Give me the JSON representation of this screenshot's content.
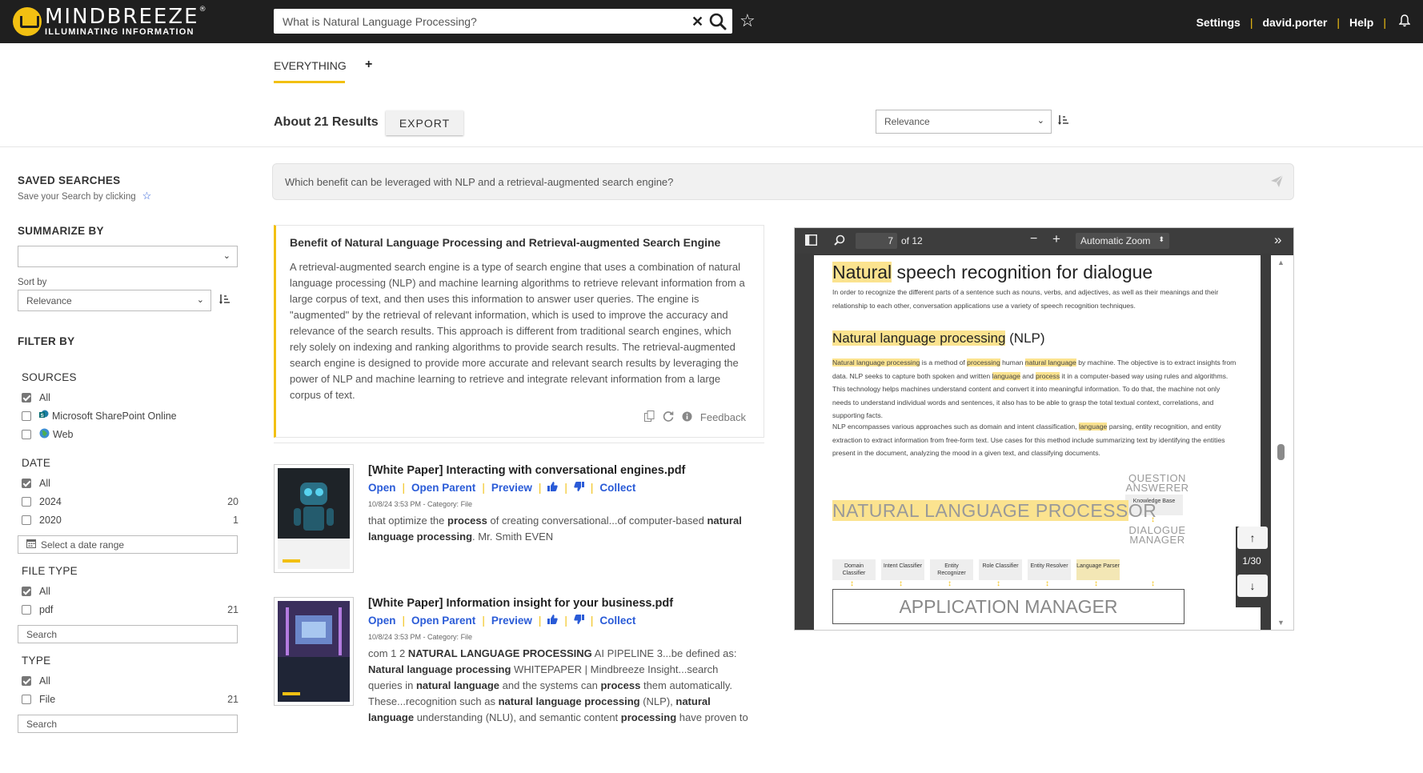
{
  "header": {
    "logo_main": "MINDBREEZE",
    "logo_reg": "®",
    "logo_sub": "ILLUMINATING INFORMATION",
    "search_value": "What is Natural Language Processing?",
    "nav": {
      "settings": "Settings",
      "user": "david.porter",
      "help": "Help"
    },
    "accent_color": "#f2c012"
  },
  "tabs": {
    "everything": "EVERYTHING",
    "add": "+"
  },
  "results_bar": {
    "count": "About 21 Results",
    "export": "EXPORT",
    "sort": "Relevance"
  },
  "ask": {
    "placeholder": "Which benefit can be leveraged with NLP and a retrieval-augmented search engine?"
  },
  "sidebar": {
    "saved_title": "SAVED SEARCHES",
    "saved_sub": "Save your Search by clicking",
    "summarize_title": "SUMMARIZE BY",
    "summarize_value": "",
    "sortby_label": "Sort by",
    "sortby_value": "Relevance",
    "filter_title": "FILTER BY",
    "sources_title": "SOURCES",
    "sources": [
      {
        "label": "All",
        "checked": true
      },
      {
        "label": "Microsoft SharePoint Online",
        "checked": false
      },
      {
        "label": "Web",
        "checked": false
      }
    ],
    "date_title": "DATE",
    "dates": [
      {
        "label": "All",
        "count": "",
        "checked": true
      },
      {
        "label": "2024",
        "count": "20",
        "checked": false
      },
      {
        "label": "2020",
        "count": "1",
        "checked": false
      }
    ],
    "date_range_placeholder": "Select a date range",
    "filetype_title": "FILE TYPE",
    "filetypes": [
      {
        "label": "All",
        "count": "",
        "checked": true
      },
      {
        "label": "pdf",
        "count": "21",
        "checked": false
      }
    ],
    "filetype_search": "Search",
    "type_title": "TYPE",
    "types": [
      {
        "label": "All",
        "count": "",
        "checked": true
      },
      {
        "label": "File",
        "count": "21",
        "checked": false
      }
    ],
    "type_search": "Search"
  },
  "answer": {
    "title": "Benefit of Natural Language Processing and Retrieval-augmented Search Engine",
    "body": "A retrieval-augmented search engine is a type of search engine that uses a combination of natural language processing (NLP) and machine learning algorithms to retrieve relevant information from a large corpus of text, and then uses this information to answer user queries. The engine is \"augmented\" by the retrieval of relevant information, which is used to improve the accuracy and relevance of the search results. This approach is different from traditional search engines, which rely solely on indexing and ranking algorithms to provide search results. The retrieval-augmented search engine is designed to provide more accurate and relevant search results by leveraging the power of NLP and machine learning to retrieve and integrate relevant information from a large corpus of text.",
    "feedback": "Feedback"
  },
  "results": [
    {
      "title": "[White Paper] Interacting with conversational engines.pdf",
      "links": {
        "open": "Open",
        "open_parent": "Open Parent",
        "preview": "Preview",
        "collect": "Collect"
      },
      "meta": "10/8/24 3:53 PM - Category: File",
      "snippet_parts": [
        "that optimize the ",
        "process",
        " of creating conversational...of computer-based ",
        "natural language processing",
        ". Mr. Smith EVEN"
      ],
      "thumb_caption": "Interacting with conversational engines"
    },
    {
      "title": "[White Paper] Information insight for your business.pdf",
      "links": {
        "open": "Open",
        "open_parent": "Open Parent",
        "preview": "Preview",
        "collect": "Collect"
      },
      "meta": "10/8/24 3:53 PM - Category: File",
      "snippet_parts": [
        "com 1 2 ",
        "NATURAL LANGUAGE PROCESSING",
        " AI PIPELINE 3...be defined as: ",
        "Natural language processing",
        " WHITEPAPER | Mindbreeze Insight...search queries in ",
        "natural language",
        " and the systems can ",
        "process",
        " them automatically. These...recognition such as ",
        "natural language processing",
        " (NLP), ",
        "natural language",
        " understanding (NLU), and semantic content ",
        "processing",
        " have proven to"
      ],
      "thumb_caption": "Information insight for your business"
    }
  ],
  "viewer": {
    "page_current": "7",
    "page_total": "of 12",
    "zoom": "Automatic Zoom",
    "page_counter": "1/30",
    "pdf": {
      "h1_hl": "Natural",
      "h1_rest": " speech recognition for dialogue",
      "p1": "In order to recognize the different parts of a sentence such as nouns, verbs, and adjectives, as well as their meanings and their relationship to each other, conversation applications use a variety of speech recognition techniques.",
      "h2_hl": "Natural language processing",
      "h2_rest": " (NLP)",
      "p2_parts": [
        "Natural language processing",
        " is a method of ",
        "processing",
        " human ",
        "natural language",
        " by machine. The objective is to extract insights from data. NLP seeks to capture both spoken and written ",
        "language",
        " and ",
        "process",
        " it in a computer-based way using rules and algorithms. This technology helps machines understand content and convert it into meaningful information. To do that, the machine not only needs to understand individual words and sentences, it also has to be able to grasp the total textual context, correlations, and supporting facts."
      ],
      "p3_parts": [
        "NLP encompasses various approaches such as domain and intent classification, ",
        "language",
        " parsing, entity recognition, and entity extraction to extract information from free-form text. Use cases for this method include summarizing text by identifying the entities present in the document, analyzing the mood in a given text, and classifying documents."
      ],
      "qa_label": "QUESTION ANSWERER",
      "kb_label": "Knowledge Base",
      "nlp_big_hl": "NATURAL LANGUAGE PROCESS",
      "nlp_big_rest": "OR",
      "dm_label": "DIALOGUE MANAGER",
      "boxes": [
        "Domain Classifier",
        "Intent Classifier",
        "Entity Recognizer",
        "Role Classifier",
        "Entity Resolver",
        "Language Parser"
      ],
      "app_manager": "APPLICATION MANAGER"
    }
  }
}
